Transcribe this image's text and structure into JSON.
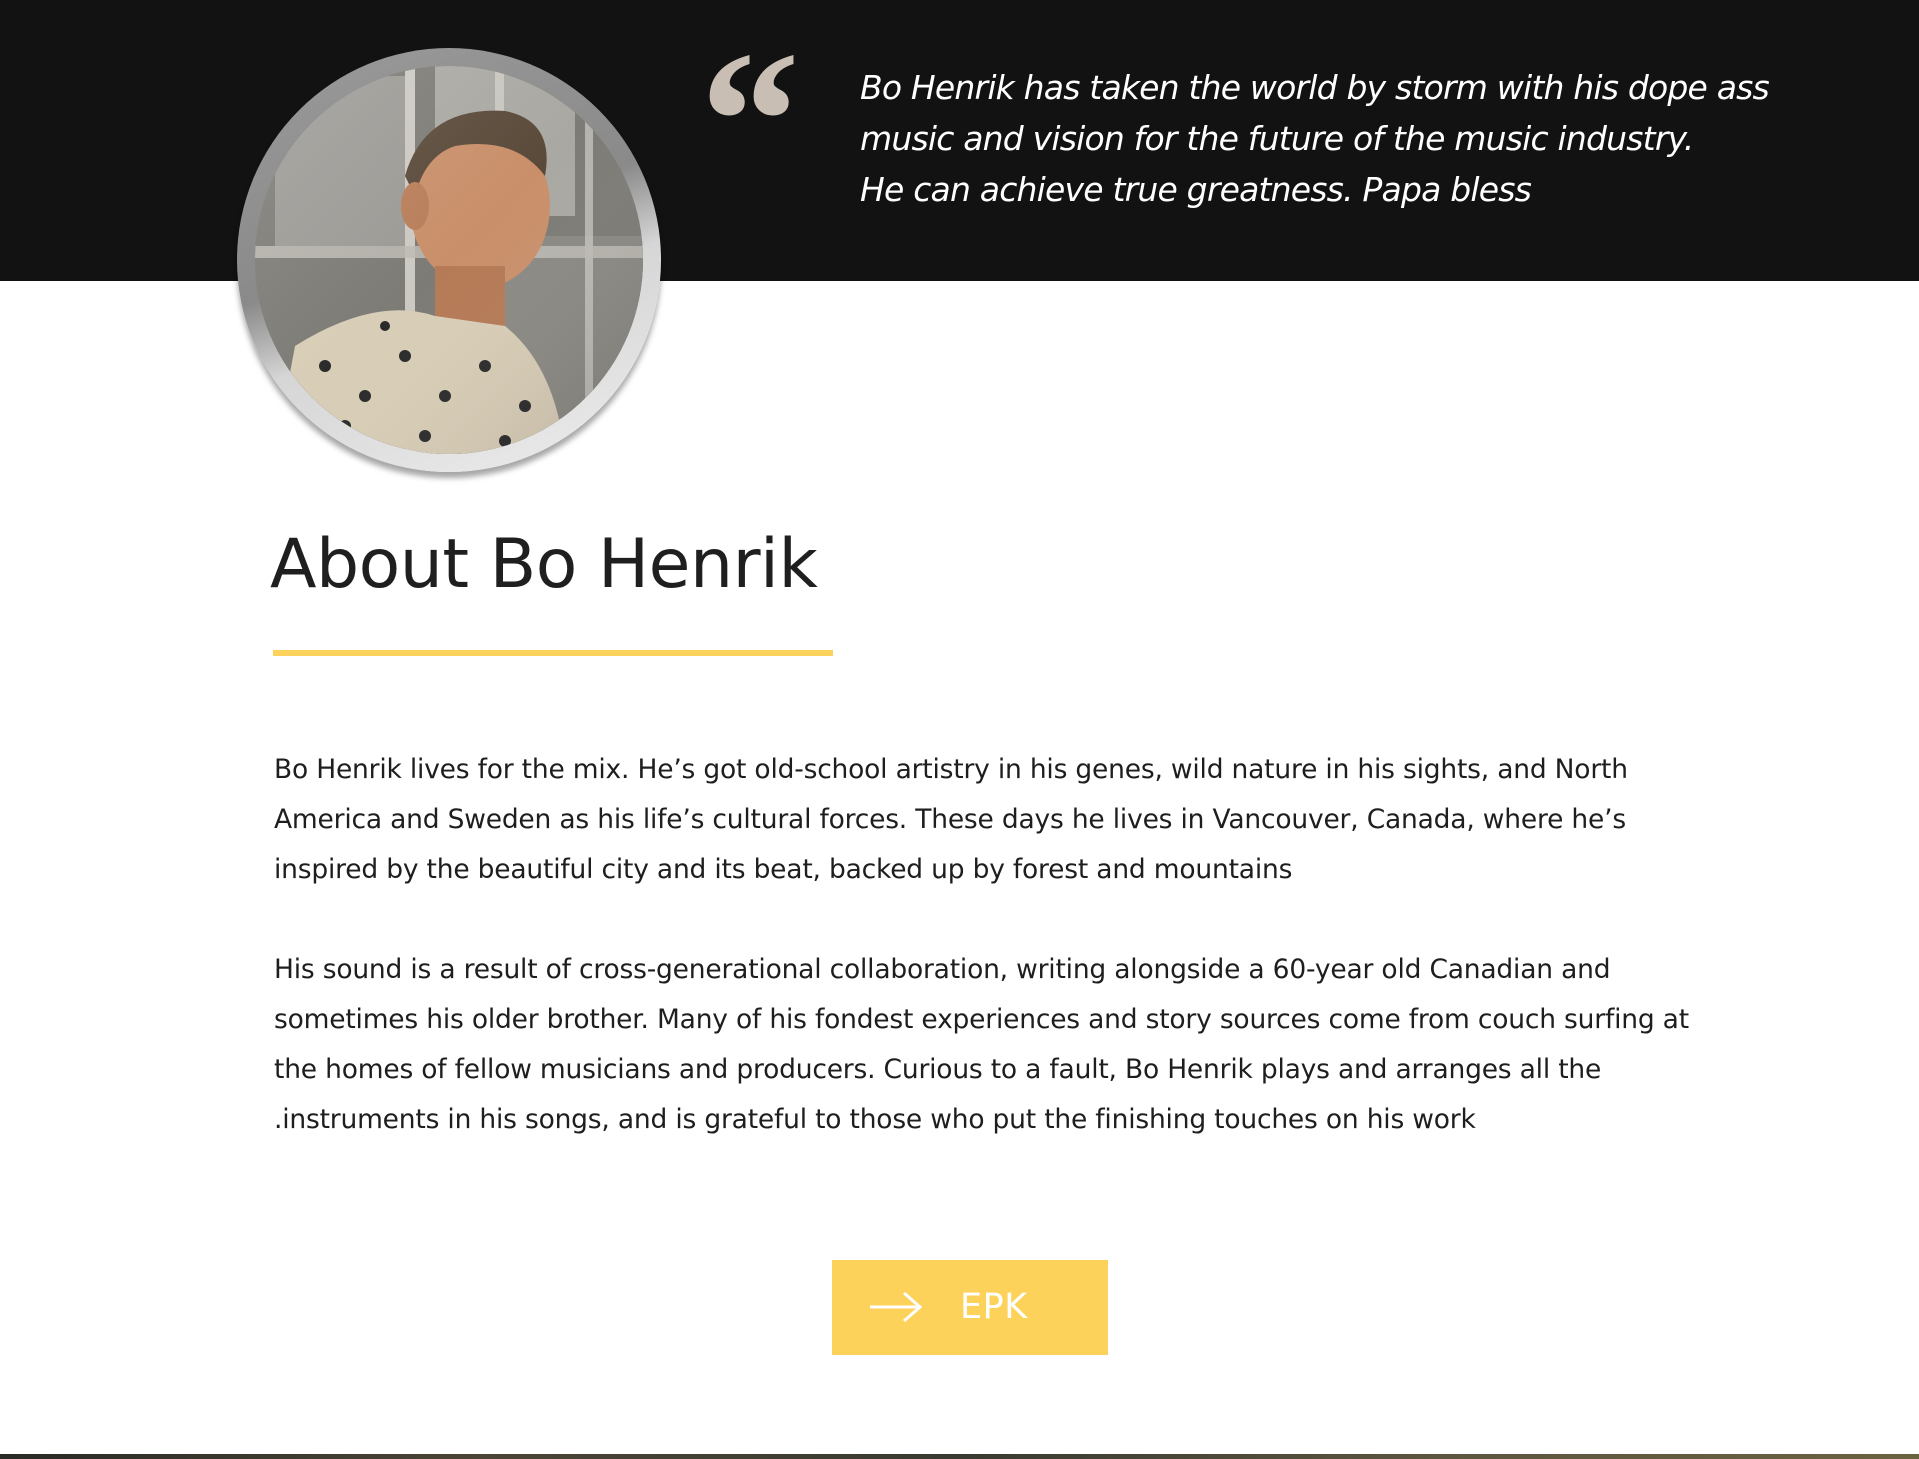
{
  "quote": {
    "mark": "“",
    "lines": [
      "Bo Henrik has taken the world by storm with his dope ass",
      "music and vision for the future of the music industry.",
      "He can achieve true greatness. Papa bless"
    ]
  },
  "about": {
    "title": "About Bo Henrik",
    "paragraph_1": [
      "Bo Henrik lives for the mix.  He’s got old-school artistry in his genes, wild nature in his sights, and North",
      "America and Sweden as his life’s cultural forces.  These days he lives in Vancouver, Canada, where he’s",
      "inspired by the beautiful city and its beat, backed up by forest and mountains"
    ],
    "paragraph_2": [
      "His sound is a result of cross-generational collaboration, writing alongside a 60-year old Canadian and",
      "sometimes his older brother. Many of his fondest experiences and story sources come from couch surfing at",
      "the homes of fellow musicians and producers.  Curious to a fault, Bo Henrik plays and arranges all the",
      ".instruments in his songs, and is grateful to those who put the finishing touches on his work"
    ]
  },
  "epk_button": {
    "label": "EPK",
    "icon": "arrow-right-icon"
  },
  "colors": {
    "header_bg": "#121212",
    "accent": "#fdd25a",
    "quote_mark": "#c9beb4",
    "body_text": "#1e1e1e"
  }
}
